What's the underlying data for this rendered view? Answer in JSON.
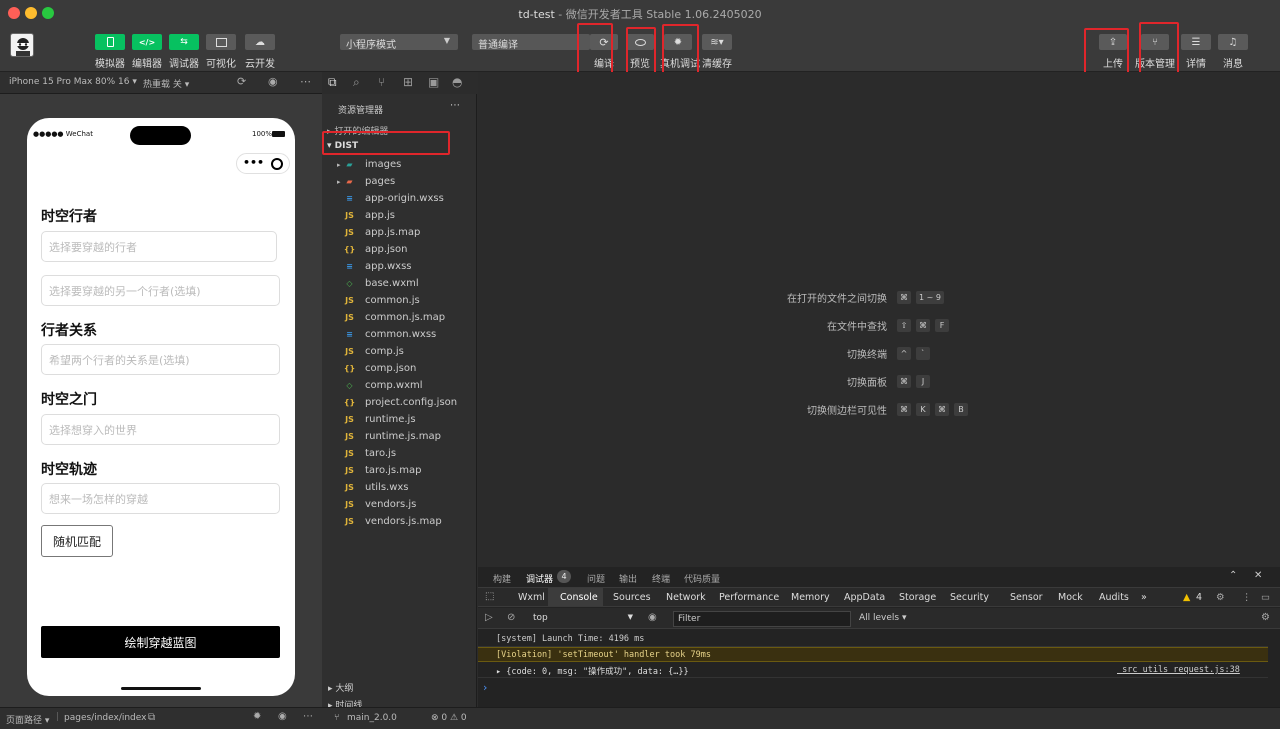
{
  "window": {
    "project_name": "td-test",
    "title_suffix": " - 微信开发者工具 Stable 1.06.2405020"
  },
  "toolbar": {
    "left_buttons": [
      {
        "label": "模拟器"
      },
      {
        "label": "编辑器"
      },
      {
        "label": "调试器"
      },
      {
        "label": "可视化"
      },
      {
        "label": "云开发"
      }
    ],
    "mode_select": "小程序模式",
    "compile_select": "普通编译",
    "action_buttons": [
      {
        "label": "编译"
      },
      {
        "label": "预览"
      },
      {
        "label": "真机调试"
      },
      {
        "label": "清缓存"
      }
    ],
    "right_buttons": [
      {
        "label": "上传"
      },
      {
        "label": "版本管理"
      },
      {
        "label": "详情"
      },
      {
        "label": "消息"
      }
    ]
  },
  "simulator": {
    "device": "iPhone 15 Pro Max 80% 16 ▾",
    "hot_reload": "热重载 关 ▾",
    "status_left": "●●●●● WeChat",
    "battery": "100%",
    "sections": [
      {
        "title": "时空行者",
        "fields": [
          "选择要穿越的行者",
          "选择要穿越的另一个行者(选填)"
        ]
      },
      {
        "title": "行者关系",
        "fields": [
          "希望两个行者的关系是(选填)"
        ]
      },
      {
        "title": "时空之门",
        "fields": [
          "选择想穿入的世界"
        ]
      },
      {
        "title": "时空轨迹",
        "fields": [
          "想来一场怎样的穿越"
        ]
      }
    ],
    "random_button": "随机匹配",
    "primary_button": "绘制穿越蓝图"
  },
  "explorer": {
    "title": "资源管理器",
    "open_editors": "打开的编辑器",
    "root": "DIST",
    "files": [
      {
        "name": "images",
        "type": "folder-img"
      },
      {
        "name": "pages",
        "type": "folder"
      },
      {
        "name": "app-origin.wxss",
        "type": "css"
      },
      {
        "name": "app.js",
        "type": "js"
      },
      {
        "name": "app.js.map",
        "type": "js"
      },
      {
        "name": "app.json",
        "type": "json"
      },
      {
        "name": "app.wxss",
        "type": "css"
      },
      {
        "name": "base.wxml",
        "type": "wxml"
      },
      {
        "name": "common.js",
        "type": "js"
      },
      {
        "name": "common.js.map",
        "type": "js"
      },
      {
        "name": "common.wxss",
        "type": "css"
      },
      {
        "name": "comp.js",
        "type": "js"
      },
      {
        "name": "comp.json",
        "type": "json"
      },
      {
        "name": "comp.wxml",
        "type": "wxml"
      },
      {
        "name": "project.config.json",
        "type": "json"
      },
      {
        "name": "runtime.js",
        "type": "js"
      },
      {
        "name": "runtime.js.map",
        "type": "js"
      },
      {
        "name": "taro.js",
        "type": "js"
      },
      {
        "name": "taro.js.map",
        "type": "js"
      },
      {
        "name": "utils.wxs",
        "type": "js"
      },
      {
        "name": "vendors.js",
        "type": "js"
      },
      {
        "name": "vendors.js.map",
        "type": "js"
      }
    ],
    "outline": "大纲",
    "timeline": "时间线"
  },
  "editor": {
    "shortcuts": [
      {
        "label": "在打开的文件之间切换",
        "keys": [
          "⌘",
          "1 ~ 9"
        ]
      },
      {
        "label": "在文件中查找",
        "keys": [
          "⇧",
          "⌘",
          "F"
        ]
      },
      {
        "label": "切换终端",
        "keys": [
          "^",
          "`"
        ]
      },
      {
        "label": "切换面板",
        "keys": [
          "⌘",
          "J"
        ]
      },
      {
        "label": "切换侧边栏可见性",
        "keys": [
          "⌘",
          "K",
          "⌘",
          "B"
        ]
      }
    ]
  },
  "panel": {
    "tabs": [
      "构建",
      "调试器",
      "问题",
      "输出",
      "终端",
      "代码质量"
    ],
    "debugger_badge": "4",
    "devtools_tabs": [
      "Wxml",
      "Console",
      "Sources",
      "Network",
      "Performance",
      "Memory",
      "AppData",
      "Storage",
      "Security",
      "Sensor",
      "Mock",
      "Audits"
    ],
    "more": "»",
    "warning_count": "4",
    "context": "top",
    "filter_placeholder": "Filter",
    "levels": "All levels ▾",
    "logs": [
      {
        "text": "[system] Launch Time: 4196 ms",
        "level": "info"
      },
      {
        "text": "[Violation] 'setTimeout' handler took 79ms",
        "level": "warn"
      },
      {
        "text": "▸ {code: 0, msg: \"操作成功\", data: {…}}",
        "level": "info",
        "source": "_src_utils_request.js:38"
      }
    ],
    "prompt": "›"
  },
  "status": {
    "page_path_label": "页面路径 ▾",
    "page_path": "pages/index/index",
    "branch": "main_2.0.0",
    "errors": "⊗ 0 ⚠ 0"
  },
  "colors": {
    "accent": "#07c160",
    "highlight": "#e0262b"
  }
}
